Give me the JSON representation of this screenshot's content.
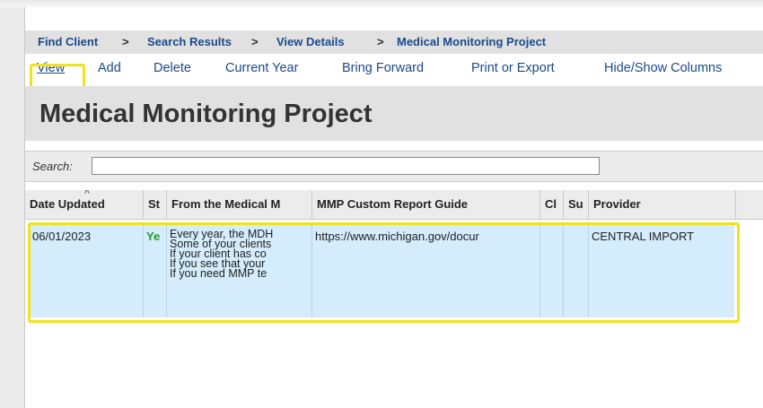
{
  "breadcrumb": [
    {
      "label": "Find Client"
    },
    {
      "label": "Search Results"
    },
    {
      "label": "View Details"
    },
    {
      "label": "Medical Monitoring Project"
    }
  ],
  "breadcrumb_separator": ">",
  "menu": {
    "view": "View",
    "add": "Add",
    "delete": "Delete",
    "current_year": "Current Year",
    "bring_forward": "Bring Forward",
    "print_export": "Print or Export",
    "hide_show": "Hide/Show Columns"
  },
  "page_title": "Medical Monitoring Project",
  "search": {
    "label": "Search:",
    "value": ""
  },
  "table": {
    "columns": [
      "Date Updated",
      "St",
      "From the Medical M",
      "MMP Custom Report Guide",
      "Cl",
      "Su",
      "Provider",
      ""
    ],
    "row": {
      "date": "06/01/2023",
      "status": "Ye",
      "note_lines": [
        "Every year, the MDH",
        "Some of your clients",
        "If your client has co",
        "If you see that your",
        "If you need MMP te"
      ],
      "guide": "https://www.michigan.gov/docur",
      "cl": "",
      "su": "",
      "provider": "CENTRAL IMPORT"
    }
  },
  "colors": {
    "highlight": "#f0e31d",
    "link": "#1a4a8a",
    "row_bg": "#d4ecfb",
    "status_green": "#2c9a2c"
  }
}
